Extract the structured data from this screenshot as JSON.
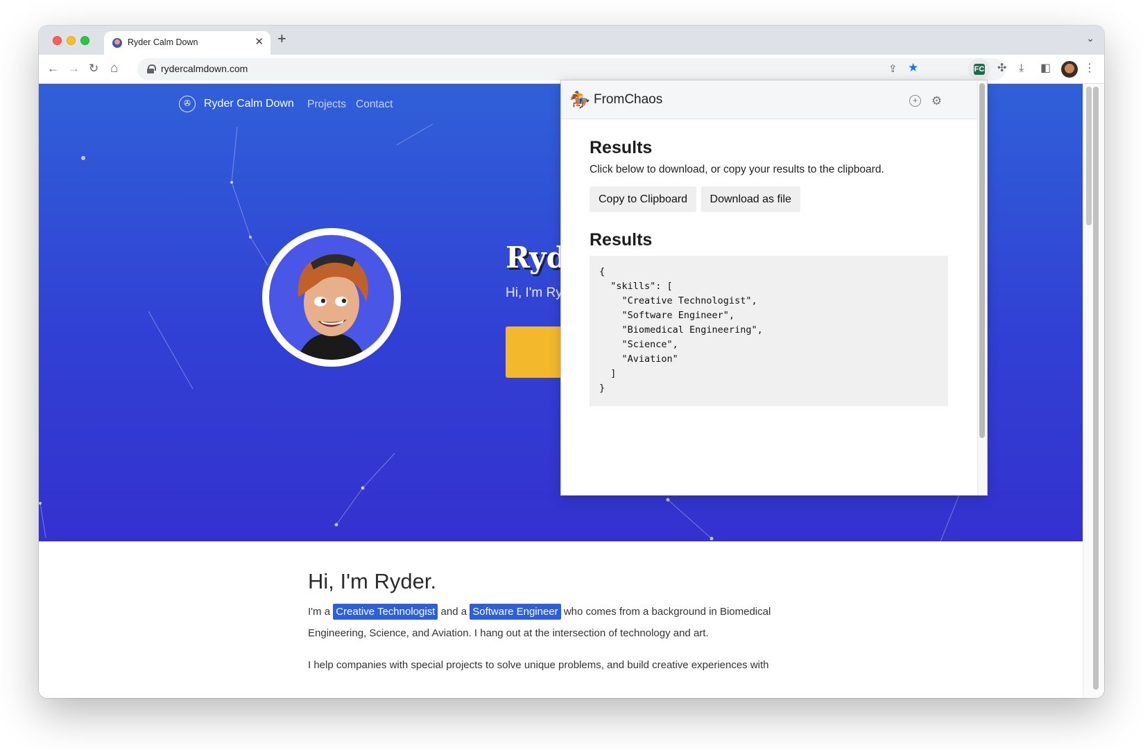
{
  "browser": {
    "tab_title": "Ryder Calm Down",
    "tab_close": "✕",
    "new_tab": "+",
    "tab_menu": "⌄",
    "url": "rydercalmdown.com",
    "back": "←",
    "forward": "→",
    "reload": "↻",
    "home": "⌂",
    "share": "⇪",
    "bookmark": "★",
    "extension_label": "FC",
    "puzzle": "✣",
    "download": "⤓",
    "sidepanel": "◧",
    "menu": "⋮"
  },
  "site": {
    "logo_glyph": "✇",
    "name": "Ryder Calm Down",
    "nav": [
      "Projects",
      "Contact"
    ],
    "hero_name": "Ryder",
    "hero_sub": "Hi, I'm Ry",
    "about_heading": "Hi, I'm Ryder.",
    "about_prefix": "I'm a",
    "about_highlight_1": "Creative Technologist",
    "about_mid": "and a",
    "about_highlight_2": "Software Engineer",
    "about_rest": "who comes from a background in Biomedical Engineering, Science, and Aviation. I hang out at the intersection of technology and art.",
    "about_second": "I help companies with special projects to solve unique problems, and build creative experiences with"
  },
  "popup": {
    "logo_glyph": "🏇",
    "title": "FromChaos",
    "add_icon": "+",
    "settings_icon": "⚙",
    "heading_1": "Results",
    "description": "Click below to download, or copy your results to the clipboard.",
    "copy_button": "Copy to Clipboard",
    "download_button": "Download as file",
    "heading_2": "Results",
    "json_output": "{\n  \"skills\": [\n    \"Creative Technologist\",\n    \"Software Engineer\",\n    \"Biomedical Engineering\",\n    \"Science\",\n    \"Aviation\"\n  ]\n}"
  },
  "colors": {
    "hero_top": "#3060d8",
    "hero_bottom": "#3431cf",
    "highlight": "#2c5fdb",
    "cta": "#f4b82d"
  }
}
